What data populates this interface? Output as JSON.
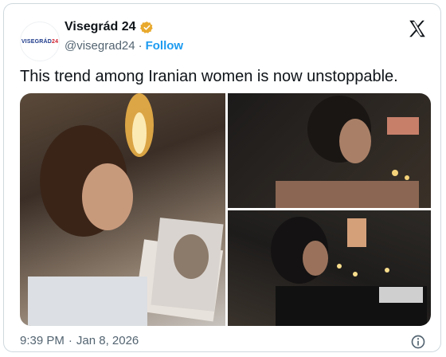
{
  "author": {
    "display_name": "Visegrád 24",
    "handle": "@visegrad24",
    "follow_label": "Follow",
    "separator": "·",
    "avatar_text_main": "VISEGRÁD",
    "avatar_text_num": "24"
  },
  "tweet": {
    "text": "This trend among Iranian women is now unstoppable."
  },
  "media": {
    "photos": [
      {
        "id": "photo-1"
      },
      {
        "id": "photo-2"
      },
      {
        "id": "photo-3"
      }
    ]
  },
  "meta": {
    "time": "9:39 PM",
    "separator": "·",
    "date": "Jan 8, 2026"
  },
  "icons": {
    "verified": "verified-badge-icon",
    "x_logo": "x-logo-icon",
    "info": "info-icon"
  },
  "colors": {
    "follow": "#1d9bf0",
    "verified": "#e8a92d",
    "secondary_text": "#536471"
  }
}
